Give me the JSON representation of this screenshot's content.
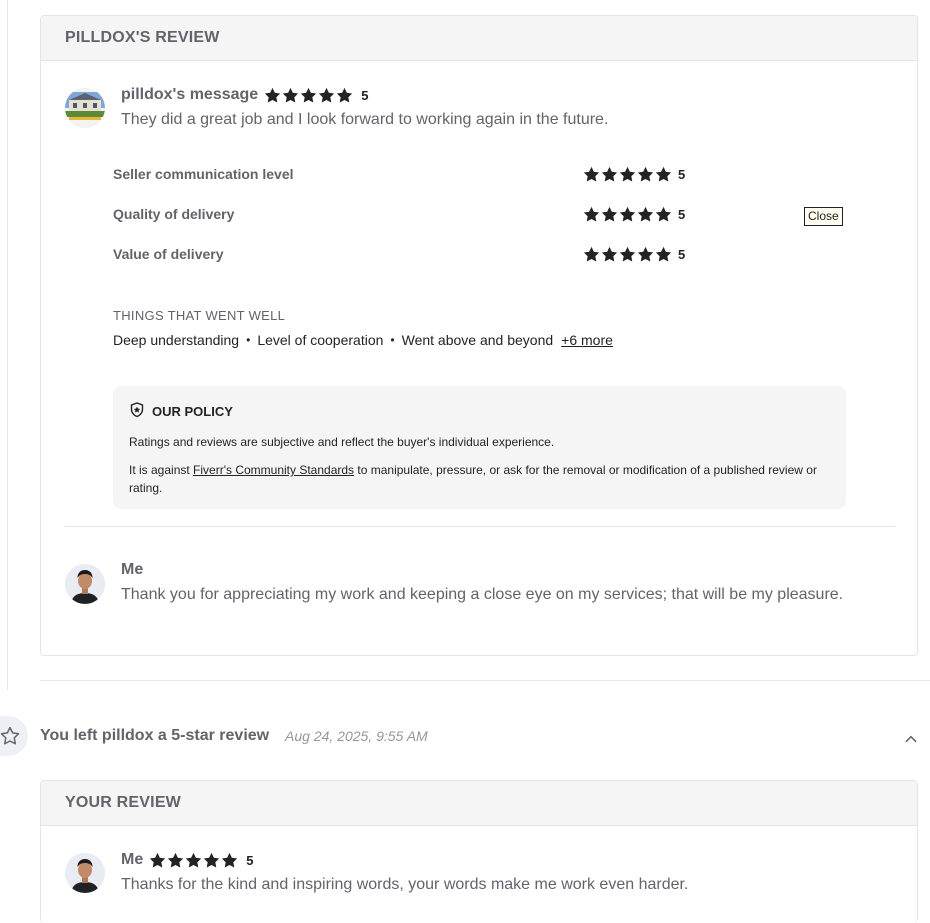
{
  "pilldox_review": {
    "header": "PILLDOX'S REVIEW",
    "message_name": "pilldox's message",
    "message_score": "5",
    "message_text": "They did a great job and I look forward to working again in the future.",
    "ratings": [
      {
        "label": "Seller communication level",
        "score": "5"
      },
      {
        "label": "Quality of delivery",
        "score": "5"
      },
      {
        "label": "Value of delivery",
        "score": "5"
      }
    ],
    "went_well_title": "THINGS THAT WENT WELL",
    "went_well_items": [
      "Deep understanding",
      "Level of cooperation",
      "Went above and beyond"
    ],
    "went_well_more": "+6 more",
    "tooltip": "Close",
    "policy": {
      "title": "OUR POLICY",
      "line1": "Ratings and reviews are subjective and reflect the buyer's individual experience.",
      "line2_pre": "It is against ",
      "line2_link": "Fiverr's Community Standards",
      "line2_post": " to manipulate, pressure, or ask for the removal or modification of a published review or rating."
    },
    "reply_name": "Me",
    "reply_text": "Thank you for appreciating my work and keeping a close eye on my services; that will be my pleasure."
  },
  "event": {
    "text": "You left pilldox a 5-star review",
    "time": "Aug 24, 2025, 9:55 AM"
  },
  "your_review": {
    "header": "YOUR REVIEW",
    "name": "Me",
    "score": "5",
    "text": "Thanks for the kind and inspiring words, your words make me work even harder."
  },
  "icons": {
    "star": "star-filled-icon",
    "policy": "shield-star-icon",
    "event": "star-outline-icon",
    "collapse": "chevron-up-icon"
  },
  "colors": {
    "star": "#222325",
    "text": "#62646a",
    "panel": "#f5f5f5"
  }
}
